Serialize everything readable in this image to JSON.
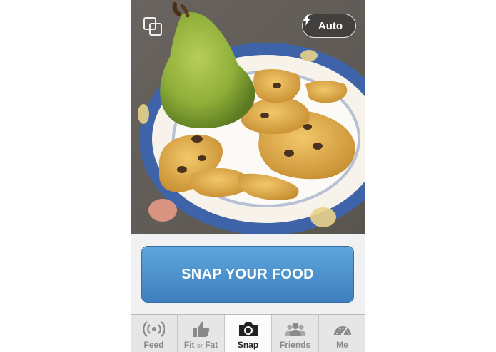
{
  "camera": {
    "switch_camera_icon": "switch-camera-icon",
    "flash": {
      "icon": "lightning-icon",
      "label": "Auto"
    }
  },
  "snap_button": {
    "label": "SNAP YOUR FOOD"
  },
  "tabbar": {
    "active": "Snap",
    "tabs": [
      {
        "label": "Feed",
        "icon": "broadcast-icon"
      },
      {
        "label_part1": "Fit",
        "label_small": "or",
        "label_part2": "Fat",
        "icon": "thumbs-up-icon"
      },
      {
        "label": "Snap",
        "icon": "camera-icon"
      },
      {
        "label": "Friends",
        "icon": "friends-icon"
      },
      {
        "label": "Me",
        "icon": "gauge-icon"
      }
    ]
  },
  "colors": {
    "snap_button": "#4b90cf",
    "tabbar_bg": "#e6e6e6",
    "active_tab_text": "#222222",
    "inactive_tab_text": "#8a8a8a"
  }
}
